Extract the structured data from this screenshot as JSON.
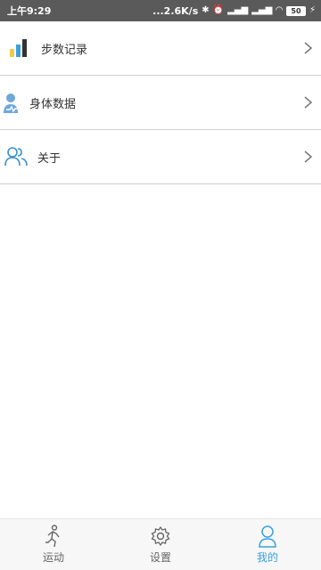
{
  "status_bar": {
    "time": "上午9:29",
    "network_speed": "...2.6K/s",
    "battery": "50"
  },
  "menu": {
    "items": [
      {
        "label": "步数记录",
        "icon": "bar-chart-icon"
      },
      {
        "label": "身体数据",
        "icon": "person-health-icon"
      },
      {
        "label": "关于",
        "icon": "people-icon"
      }
    ]
  },
  "tab_bar": {
    "tabs": [
      {
        "label": "运动",
        "icon": "running-icon",
        "active": false
      },
      {
        "label": "设置",
        "icon": "gear-icon",
        "active": false
      },
      {
        "label": "我的",
        "icon": "profile-icon",
        "active": true
      }
    ]
  },
  "colors": {
    "accent": "#3aa0e0",
    "status_bar_bg": "#5a5a5a",
    "divider": "#cfcfcf"
  }
}
